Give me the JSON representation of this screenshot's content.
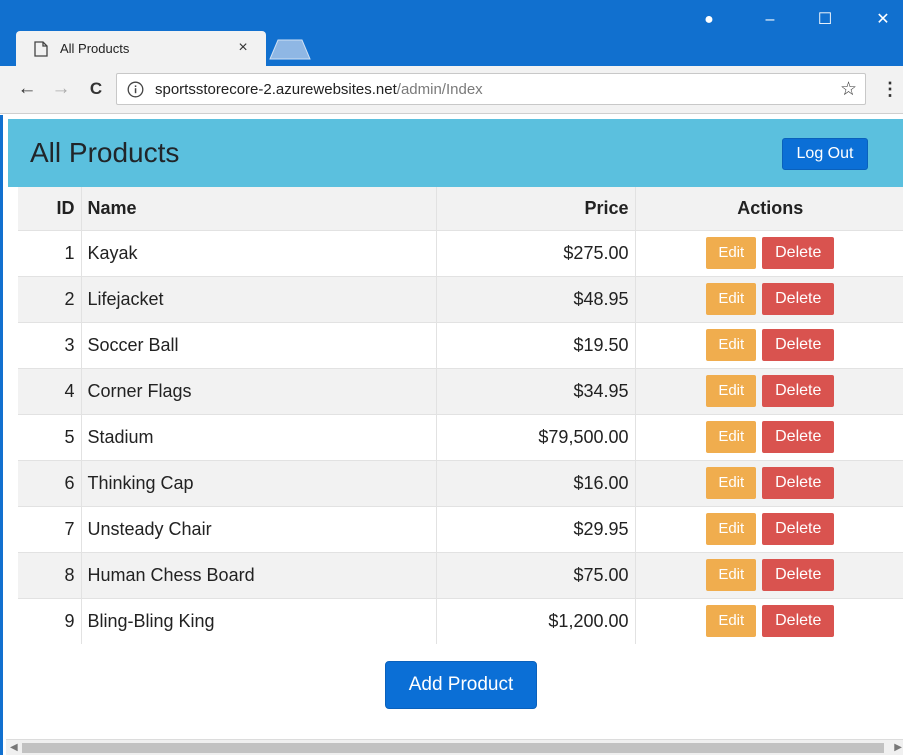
{
  "browser": {
    "tab_title": "All Products",
    "tab_close": "×",
    "url_host": "sportsstorecore-2.azurewebsites.net",
    "url_path": "/admin/Index",
    "controls": {
      "minimize": "–",
      "maximize": "☐",
      "close": "✕",
      "profile": "●"
    },
    "nav": {
      "back": "←",
      "forward": "→",
      "reload": "C",
      "menu": "⋮",
      "bookmark": "☆"
    }
  },
  "header": {
    "title": "All Products",
    "logout_label": "Log Out"
  },
  "table": {
    "columns": {
      "id": "ID",
      "name": "Name",
      "price": "Price",
      "actions": "Actions"
    },
    "rows": [
      {
        "id": "1",
        "name": "Kayak",
        "price": "$275.00"
      },
      {
        "id": "2",
        "name": "Lifejacket",
        "price": "$48.95"
      },
      {
        "id": "3",
        "name": "Soccer Ball",
        "price": "$19.50"
      },
      {
        "id": "4",
        "name": "Corner Flags",
        "price": "$34.95"
      },
      {
        "id": "5",
        "name": "Stadium",
        "price": "$79,500.00"
      },
      {
        "id": "6",
        "name": "Thinking Cap",
        "price": "$16.00"
      },
      {
        "id": "7",
        "name": "Unsteady Chair",
        "price": "$29.95"
      },
      {
        "id": "8",
        "name": "Human Chess Board",
        "price": "$75.00"
      },
      {
        "id": "9",
        "name": "Bling-Bling King",
        "price": "$1,200.00"
      }
    ],
    "edit_label": "Edit",
    "delete_label": "Delete"
  },
  "footer": {
    "add_label": "Add Product"
  },
  "colors": {
    "titlebar": "#1170cf",
    "header_bar": "#5bc0de",
    "primary": "#0b6fd6",
    "warning": "#f0ad4e",
    "danger": "#d9534f"
  }
}
